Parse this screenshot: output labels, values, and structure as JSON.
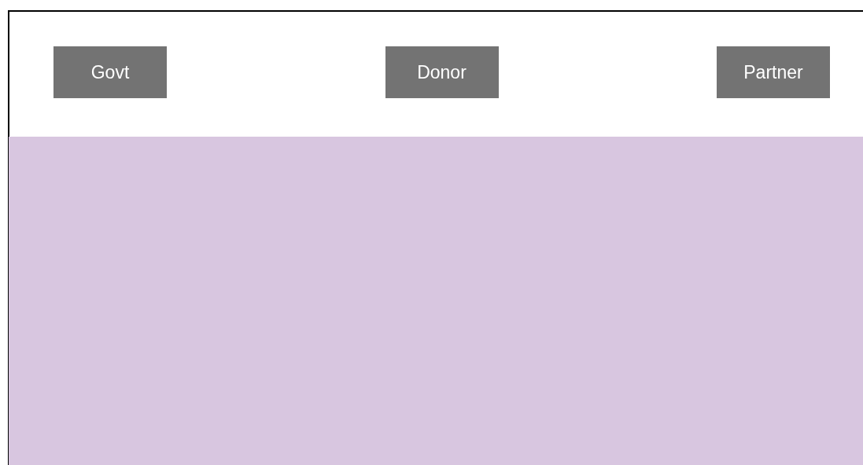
{
  "buttons": [
    {
      "label": "Govt"
    },
    {
      "label": "Donor"
    },
    {
      "label": "Partner"
    }
  ]
}
